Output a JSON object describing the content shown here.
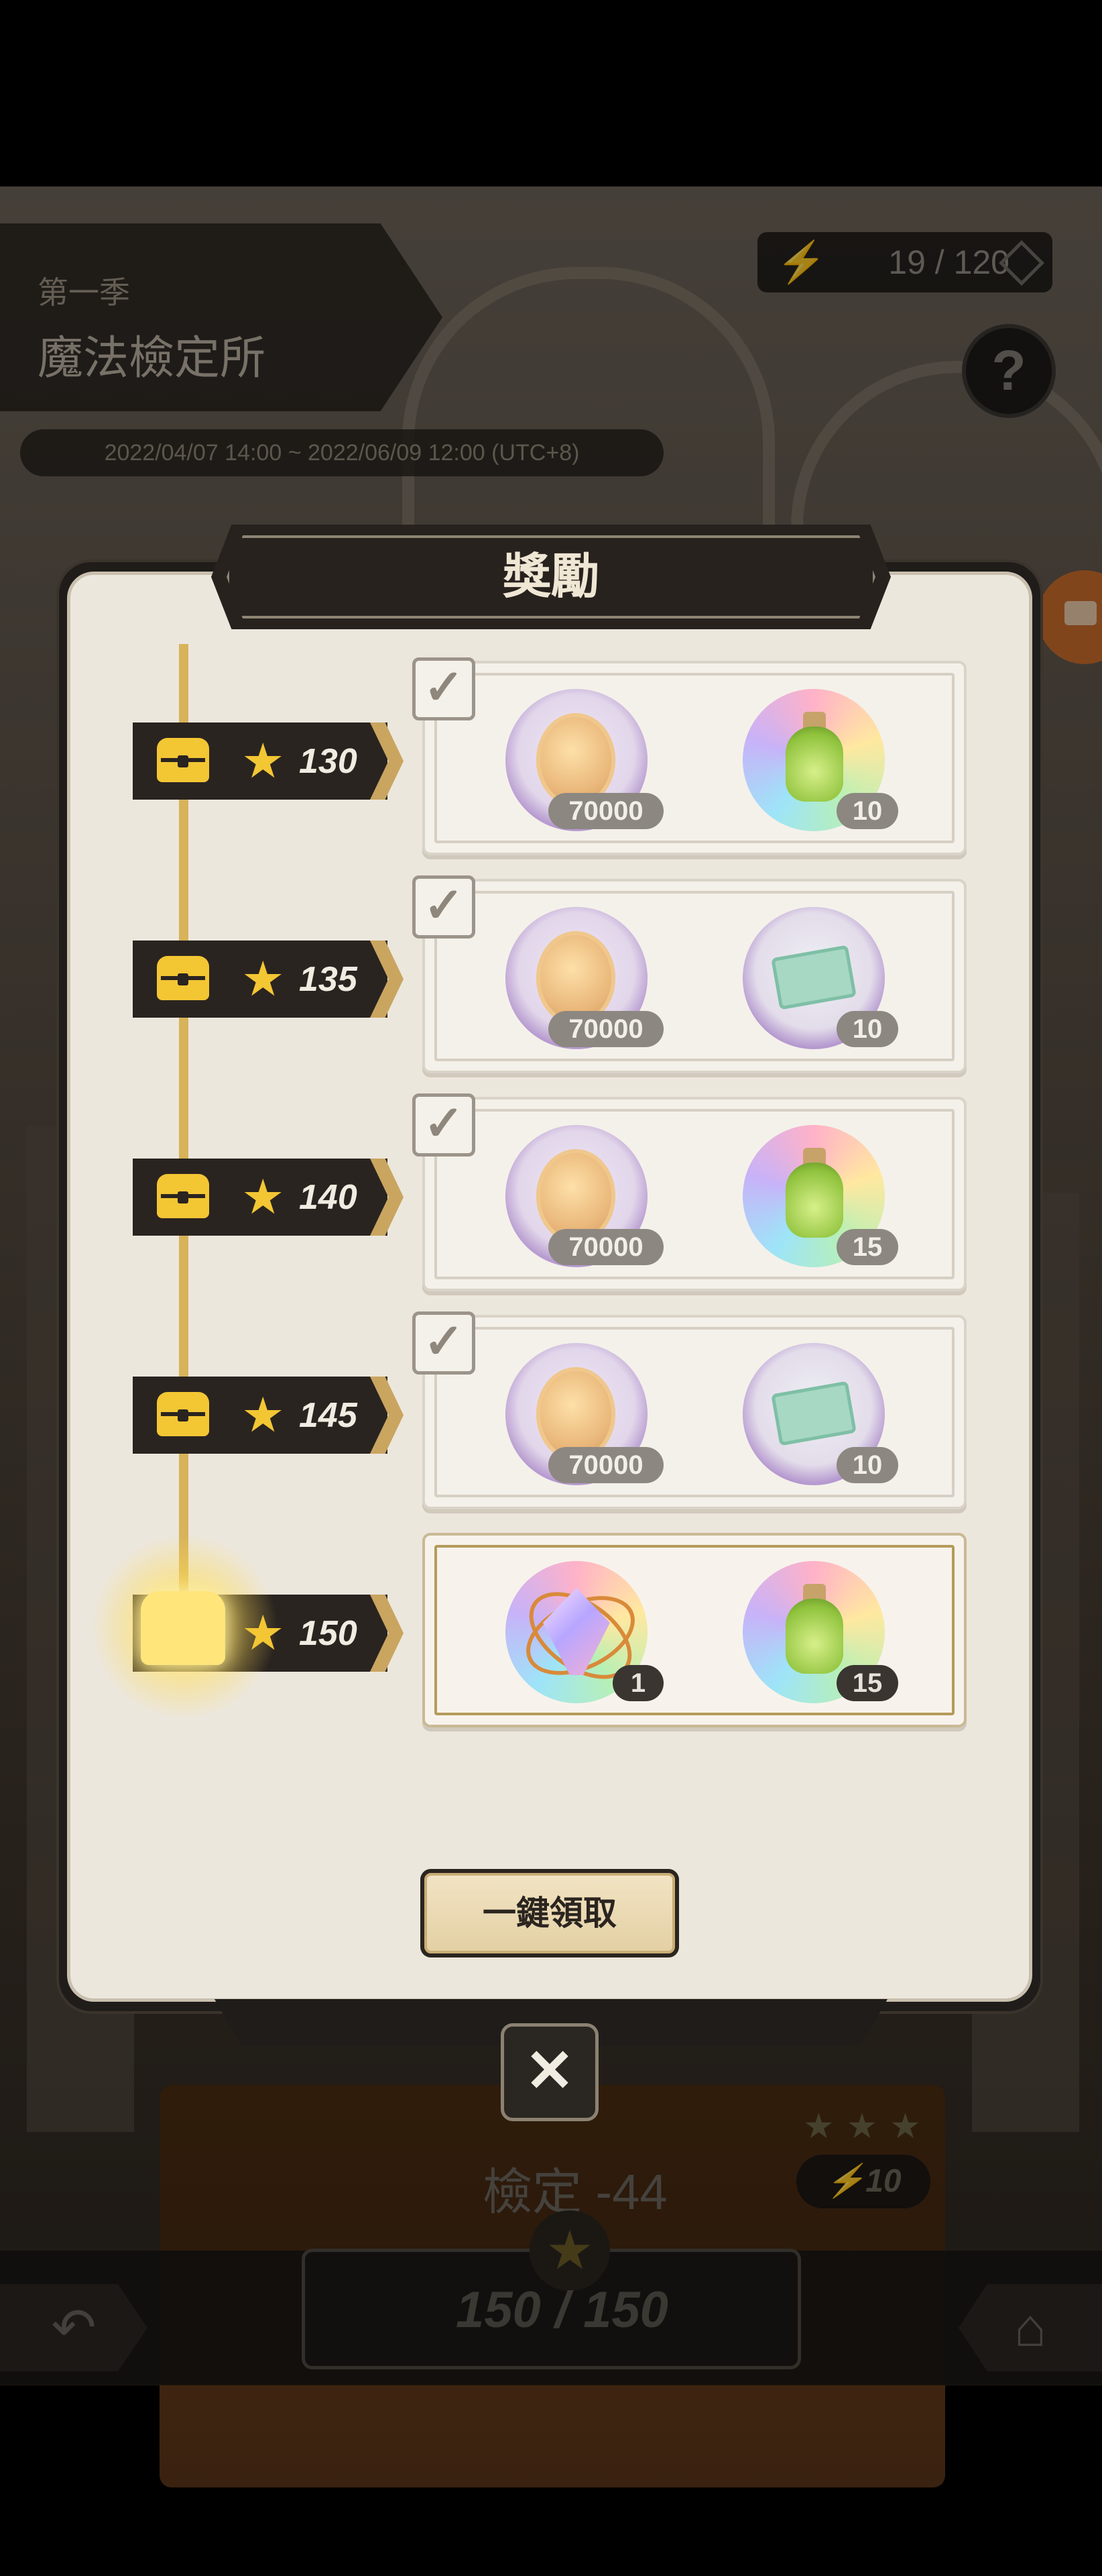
{
  "background": {
    "season_label": "第一季",
    "event_title": "魔法檢定所",
    "date_range": "2022/04/07 14:00 ~ 2022/06/09 12:00 (UTC+8)",
    "energy": "19 / 120",
    "help": "?",
    "stage_title": "檢定 -44",
    "stage_cost": "10",
    "stage_stars": "★★★",
    "progress": "150 / 150",
    "energy_icon": "bolt-icon",
    "accent_brown": "#4a2c12"
  },
  "modal": {
    "title": "獎勵",
    "claim_all_label": "一鍵領取",
    "close_symbol": "✕",
    "tiers": [
      {
        "stars": "130",
        "claimed": true,
        "rewards": [
          {
            "icon": "gold-coin-icon",
            "qty": "70000"
          },
          {
            "icon": "green-potion-icon",
            "qty": "10"
          }
        ]
      },
      {
        "stars": "135",
        "claimed": true,
        "rewards": [
          {
            "icon": "gold-coin-icon",
            "qty": "70000"
          },
          {
            "icon": "ticket-icon",
            "qty": "10"
          }
        ]
      },
      {
        "stars": "140",
        "claimed": true,
        "rewards": [
          {
            "icon": "gold-coin-icon",
            "qty": "70000"
          },
          {
            "icon": "green-potion-icon",
            "qty": "15"
          }
        ]
      },
      {
        "stars": "145",
        "claimed": true,
        "rewards": [
          {
            "icon": "gold-coin-icon",
            "qty": "70000"
          },
          {
            "icon": "ticket-icon",
            "qty": "10"
          }
        ]
      },
      {
        "stars": "150",
        "claimed": false,
        "rewards": [
          {
            "icon": "crystal-icon",
            "qty": "1"
          },
          {
            "icon": "green-potion-icon",
            "qty": "15"
          }
        ]
      }
    ],
    "colors": {
      "chest_gold": "#f3c634",
      "track_gold": "#d7b35a",
      "label_dark": "#2a2420"
    }
  }
}
